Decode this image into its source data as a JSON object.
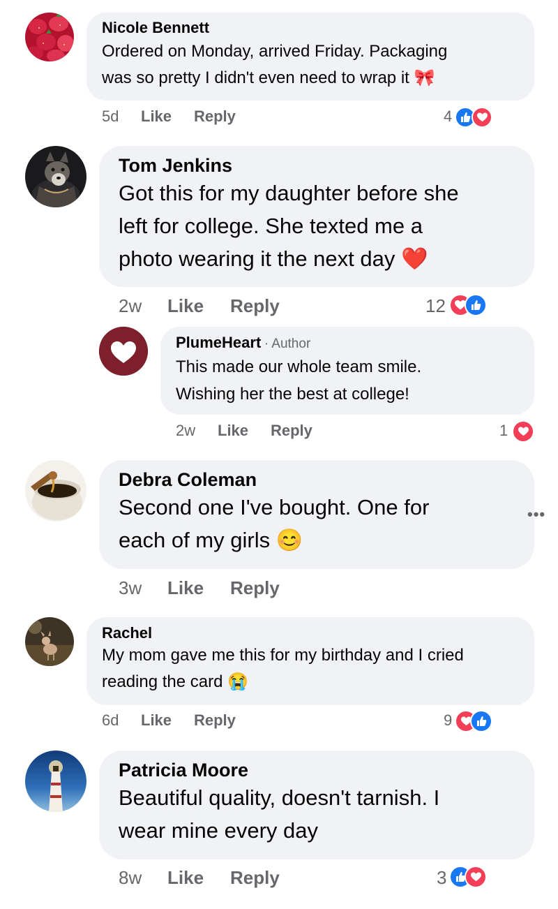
{
  "comments": [
    {
      "name": "Nicole Bennett",
      "text": "Ordered on Monday, arrived Friday. Packaging\nwas so pretty I didn't even need to wrap it 🎀",
      "time": "5d",
      "like": "Like",
      "reply": "Reply",
      "reaction_count": "4",
      "reactions": [
        "like",
        "love"
      ],
      "avatar": "strawberries"
    },
    {
      "name": "Tom Jenkins",
      "text": "Got this for my daughter before she\nleft for college. She texted me a\nphoto wearing it the next day ❤️",
      "time": "2w",
      "like": "Like",
      "reply": "Reply",
      "reaction_count": "12",
      "reactions": [
        "love",
        "like"
      ],
      "avatar": "husky",
      "reply_comment": {
        "name": "PlumeHeart",
        "author_label": "· Author",
        "text": "This made our whole team smile.\nWishing her the best at college!",
        "time": "2w",
        "like": "Like",
        "reply": "Reply",
        "reaction_count": "1",
        "reactions": [
          "love"
        ],
        "avatar": "heart-logo",
        "brand_color": "#7e1f2c"
      }
    },
    {
      "name": "Debra Coleman",
      "text": "Second one I've bought. One for\neach of my girls 😊",
      "time": "3w",
      "like": "Like",
      "reply": "Reply",
      "avatar": "honey-pot",
      "more_menu": "•••"
    },
    {
      "name": "Rachel",
      "text": "My mom gave me this for my birthday and I cried\nreading the card 😭",
      "time": "6d",
      "like": "Like",
      "reply": "Reply",
      "reaction_count": "9",
      "reactions": [
        "love",
        "like"
      ],
      "avatar": "fawn"
    },
    {
      "name": "Patricia Moore",
      "text": "Beautiful quality, doesn't tarnish. I\nwear mine every day",
      "time": "8w",
      "like": "Like",
      "reply": "Reply",
      "reaction_count": "3",
      "reactions": [
        "like",
        "love"
      ],
      "avatar": "lighthouse"
    }
  ],
  "colors": {
    "bubble": "#f0f2f5",
    "secondary_text": "#65676b",
    "like_blue": "#1877f2",
    "love_red": "#f33e58"
  }
}
